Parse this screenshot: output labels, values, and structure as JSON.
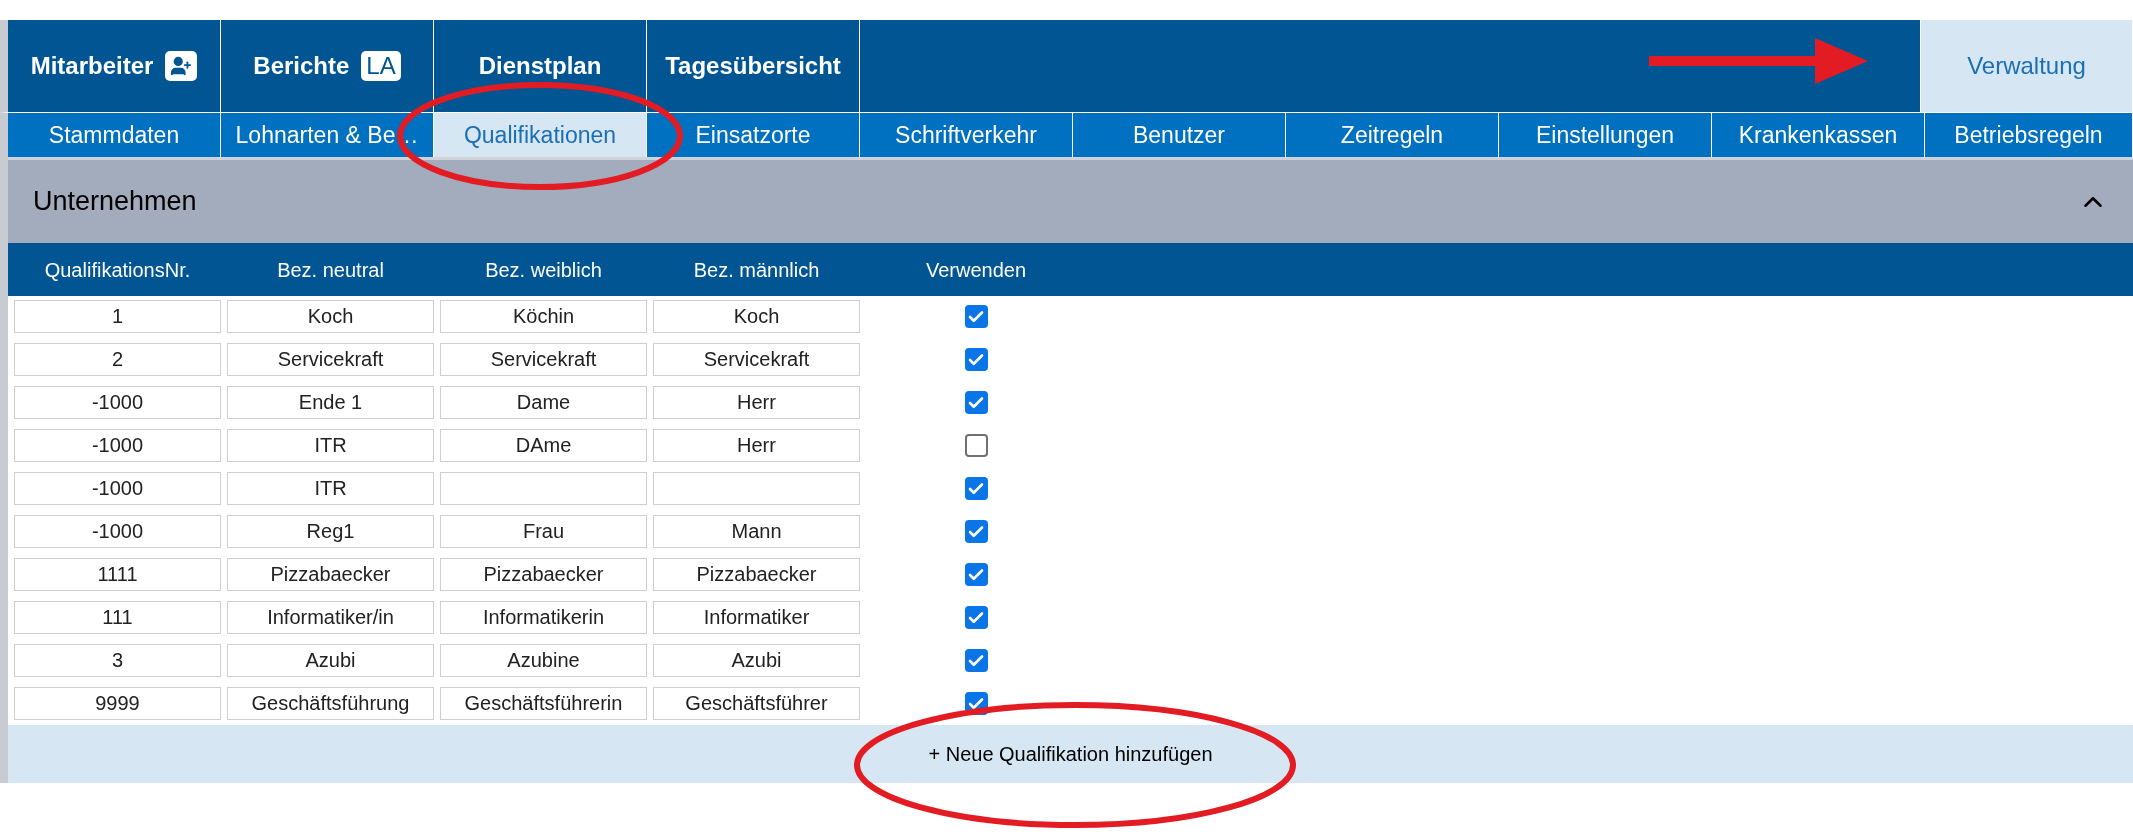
{
  "main_tabs": [
    {
      "label": "Mitarbeiter",
      "kind": "icon",
      "selected": false
    },
    {
      "label": "Berichte",
      "kind": "badge",
      "badge": "LA",
      "selected": false
    },
    {
      "label": "Dienstplan",
      "kind": "plain",
      "selected": false
    },
    {
      "label": "Tagesübersicht",
      "kind": "plain",
      "selected": false
    },
    {
      "label": "Verwaltung",
      "kind": "plain",
      "selected": true
    }
  ],
  "sub_tabs": [
    {
      "label": "Stammdaten",
      "selected": false
    },
    {
      "label": "Lohnarten & Be…",
      "selected": false
    },
    {
      "label": "Qualifikationen",
      "selected": true
    },
    {
      "label": "Einsatzorte",
      "selected": false
    },
    {
      "label": "Schriftverkehr",
      "selected": false
    },
    {
      "label": "Benutzer",
      "selected": false
    },
    {
      "label": "Zeitregeln",
      "selected": false
    },
    {
      "label": "Einstellungen",
      "selected": false
    },
    {
      "label": "Krankenkassen",
      "selected": false
    },
    {
      "label": "Betriebsregeln",
      "selected": false
    }
  ],
  "section": {
    "title": "Unternehmen",
    "expanded": true
  },
  "table": {
    "columns": [
      "QualifikationsNr.",
      "Bez. neutral",
      "Bez. weiblich",
      "Bez. männlich",
      "Verwenden"
    ],
    "rows": [
      {
        "cells": [
          "1",
          "Koch",
          "Köchin",
          "Koch"
        ],
        "checked": true
      },
      {
        "cells": [
          "2",
          "Servicekraft",
          "Servicekraft",
          "Servicekraft"
        ],
        "checked": true
      },
      {
        "cells": [
          "-1000",
          "Ende 1",
          "Dame",
          "Herr"
        ],
        "checked": true
      },
      {
        "cells": [
          "-1000",
          "ITR",
          "DAme",
          "Herr"
        ],
        "checked": false
      },
      {
        "cells": [
          "-1000",
          "ITR",
          null,
          null
        ],
        "checked": true
      },
      {
        "cells": [
          "-1000",
          "Reg1",
          "Frau",
          "Mann"
        ],
        "checked": true
      },
      {
        "cells": [
          "1111",
          "Pizzabaecker",
          "Pizzabaecker",
          "Pizzabaecker"
        ],
        "checked": true
      },
      {
        "cells": [
          "111",
          "Informatiker/in",
          "Informatikerin",
          "Informatiker"
        ],
        "checked": true
      },
      {
        "cells": [
          "3",
          "Azubi",
          "Azubine",
          "Azubi"
        ],
        "checked": true
      },
      {
        "cells": [
          "9999",
          "Geschäftsführung",
          "Geschäftsführerin",
          "Geschäftsführer"
        ],
        "checked": true
      }
    ]
  },
  "add_button": "+ Neue Qualifikation hinzufügen"
}
